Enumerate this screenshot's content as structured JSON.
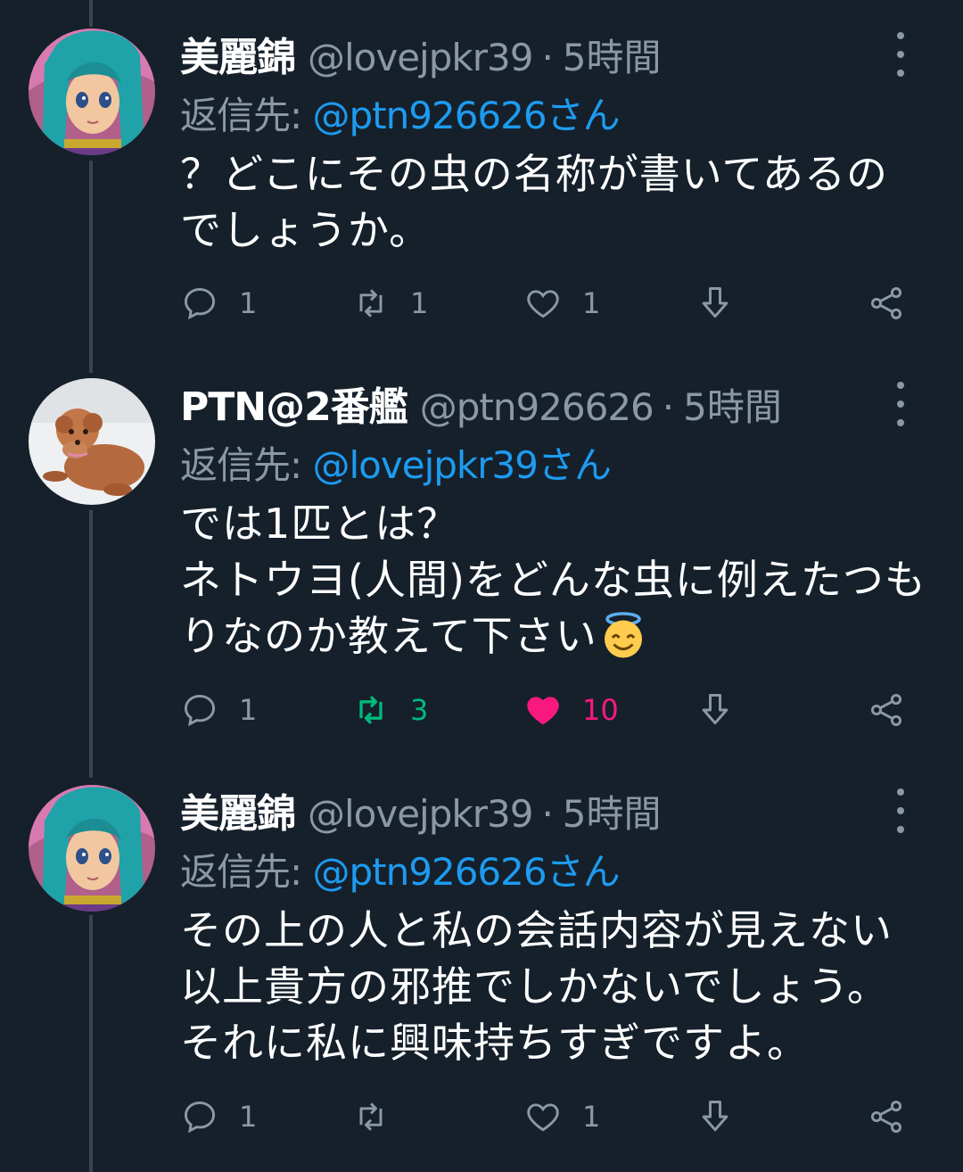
{
  "tweets": [
    {
      "name": "美麗錦",
      "handle": "@lovejpkr39",
      "separator": "·",
      "time": "5時間",
      "replying_prefix": "返信先:",
      "replying_to": "@ptn926626さん",
      "body_lines": [
        "？どこにその虫の名称が書いてあるの",
        "でしょうか。"
      ],
      "reply_count": "1",
      "retweet_count": "1",
      "like_count": "1",
      "liked": false,
      "retweeted": false
    },
    {
      "name": "PTN@2番艦",
      "handle": "@ptn926626",
      "separator": "·",
      "time": "5時間",
      "replying_prefix": "返信先:",
      "replying_to": "@lovejpkr39さん",
      "body_lines": [
        "では1匹とは？",
        "ネトウヨ(人間)をどんな虫に例えたつも",
        "りなのか教えて下さい"
      ],
      "emoji": "smiling-face-with-halo",
      "reply_count": "1",
      "retweet_count": "3",
      "like_count": "10",
      "liked": true,
      "retweeted": true
    },
    {
      "name": "美麗錦",
      "handle": "@lovejpkr39",
      "separator": "·",
      "time": "5時間",
      "replying_prefix": "返信先:",
      "replying_to": "@ptn926626さん",
      "body_lines": [
        "その上の人と私の会話内容が見えない",
        "以上貴方の邪推でしかないでしょう。",
        "それに私に興味持ちすぎですよ。"
      ],
      "reply_count": "1",
      "retweet_count": "",
      "like_count": "1",
      "liked": false,
      "retweeted": false
    }
  ],
  "colors": {
    "background": "#15202b",
    "text": "#ffffff",
    "secondary": "#8b98a5",
    "link": "#1d9bf0",
    "retweet_active": "#00ba7c",
    "like_active": "#f91880",
    "thread_line": "#38444d"
  },
  "icons": [
    "reply-icon",
    "retweet-icon",
    "like-icon",
    "download-icon",
    "share-icon",
    "more-icon"
  ]
}
